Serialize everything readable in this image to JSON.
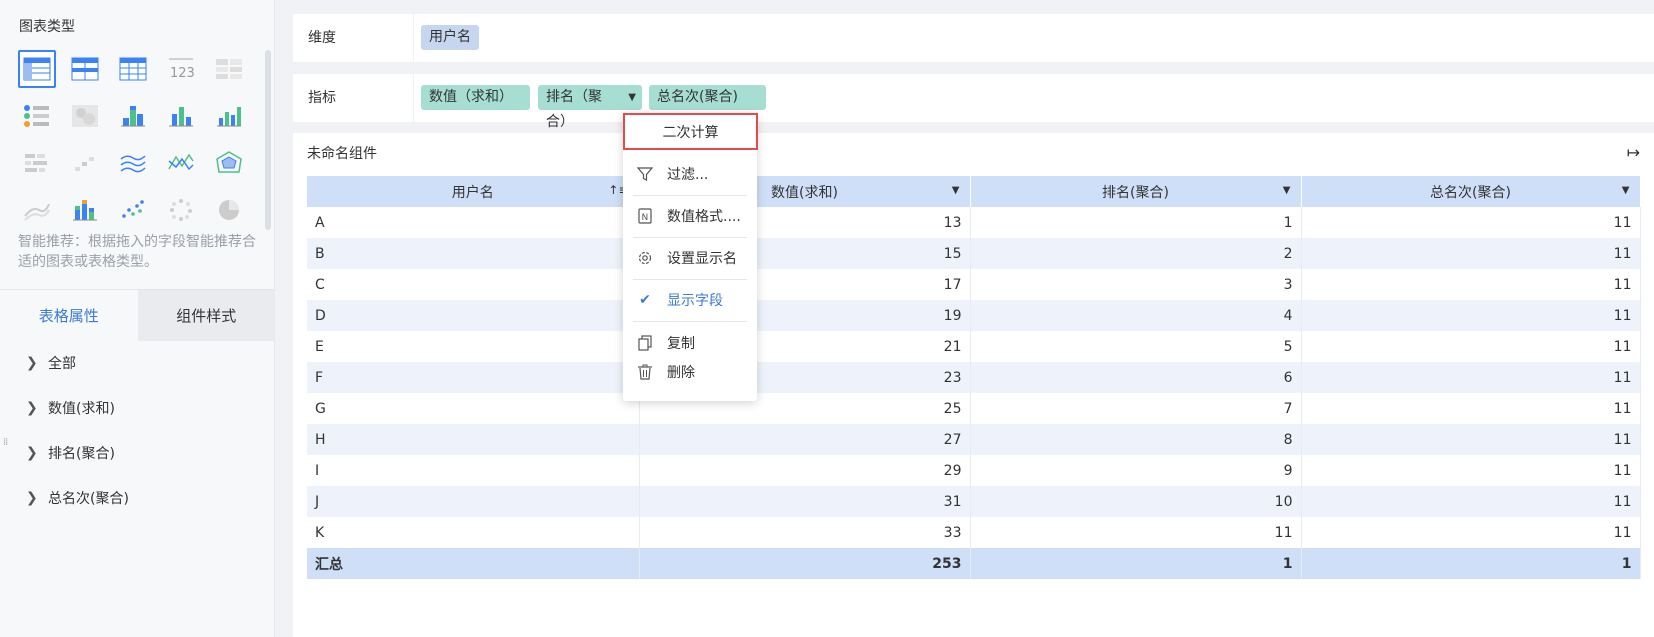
{
  "left_panel": {
    "chart_type_title": "图表类型",
    "chart_icons": [
      "table-icon",
      "cross-table-icon",
      "detail-table-icon",
      "kpi-number-icon",
      "multi-kpi-icon",
      "indicator-card-icon",
      "heatmap-icon",
      "grouped-bar-icon",
      "column-chart-icon",
      "bar-chart-icon",
      "funnel-icon",
      "scatter-small-icon",
      "multi-line-icon",
      "line-chart-icon",
      "radar-icon",
      "area-icon",
      "stacked-column-icon",
      "scatter-icon",
      "dot-ring-icon",
      "pie-chart-icon"
    ],
    "recommend_text": "智能推荐：根据拖入的字段智能推荐合适的图表或表格类型。",
    "tabs": [
      "表格属性",
      "组件样式"
    ],
    "properties": [
      "全部",
      "数值(求和)",
      "排名(聚合)",
      "总名次(聚合)"
    ]
  },
  "dimension_row": {
    "label": "维度",
    "fields": [
      "用户名"
    ]
  },
  "measure_row": {
    "label": "指标",
    "fields": [
      "数值（求和）",
      "排名（聚合）",
      "总名次(聚合)"
    ]
  },
  "widget": {
    "title": "未命名组件",
    "columns": [
      "用户名",
      "数值(求和)",
      "排名(聚合)",
      "总名次(聚合)"
    ],
    "rows": [
      [
        "A",
        "13",
        "1",
        "11"
      ],
      [
        "B",
        "15",
        "2",
        "11"
      ],
      [
        "C",
        "17",
        "3",
        "11"
      ],
      [
        "D",
        "19",
        "4",
        "11"
      ],
      [
        "E",
        "21",
        "5",
        "11"
      ],
      [
        "F",
        "23",
        "6",
        "11"
      ],
      [
        "G",
        "25",
        "7",
        "11"
      ],
      [
        "H",
        "27",
        "8",
        "11"
      ],
      [
        "I",
        "29",
        "9",
        "11"
      ],
      [
        "J",
        "31",
        "10",
        "11"
      ],
      [
        "K",
        "33",
        "11",
        "11"
      ]
    ],
    "total": [
      "汇总",
      "253",
      "1",
      "1"
    ]
  },
  "menu": {
    "head": "二次计算",
    "items": [
      "过滤...",
      "数值格式....",
      "设置显示名",
      "显示字段",
      "复制",
      "删除"
    ]
  },
  "colors": {
    "accent": "#3a7bd5",
    "dimension_pill": "#c7d6ef",
    "measure_pill": "#a6ded4",
    "header_bg": "#cfdff7",
    "highlight_border": "#e24c4c"
  }
}
